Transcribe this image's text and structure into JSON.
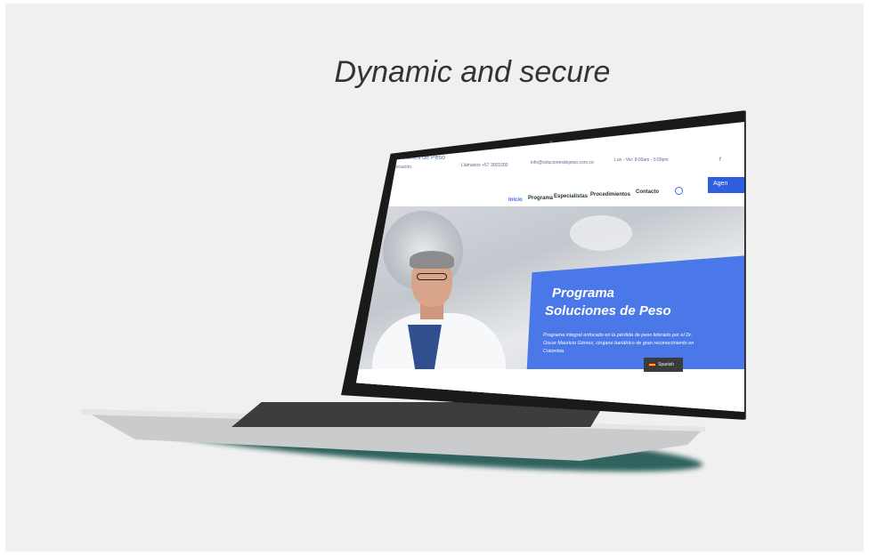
{
  "headline": "Dynamic and secure",
  "website": {
    "topbar": {
      "location": "Ubicación",
      "phone": "Llámanos +57 3001000",
      "email": "info@solucionesdepeso.com.co",
      "hours": "Lun - Vie: 8:00am - 5:00pm",
      "social": "f"
    },
    "logo": "Soluciones de Peso",
    "nav": [
      "Inicio",
      "Programa",
      "Especialistas",
      "Procedimientos",
      "Contacto"
    ],
    "cta": "Agen",
    "hero": {
      "title_line1": "Programa",
      "title_line2": "Soluciones de Peso",
      "description": "Programa integral enfocado en la pérdida de peso liderado por el Dr. Oscar Mauricio Gómez, cirujano bariátrico de gran reconocimiento en Colombia",
      "language": "Spanish"
    }
  },
  "colors": {
    "accent": "#4a78e8",
    "cta": "#2f5fe0",
    "background": "#f0f0f0"
  }
}
